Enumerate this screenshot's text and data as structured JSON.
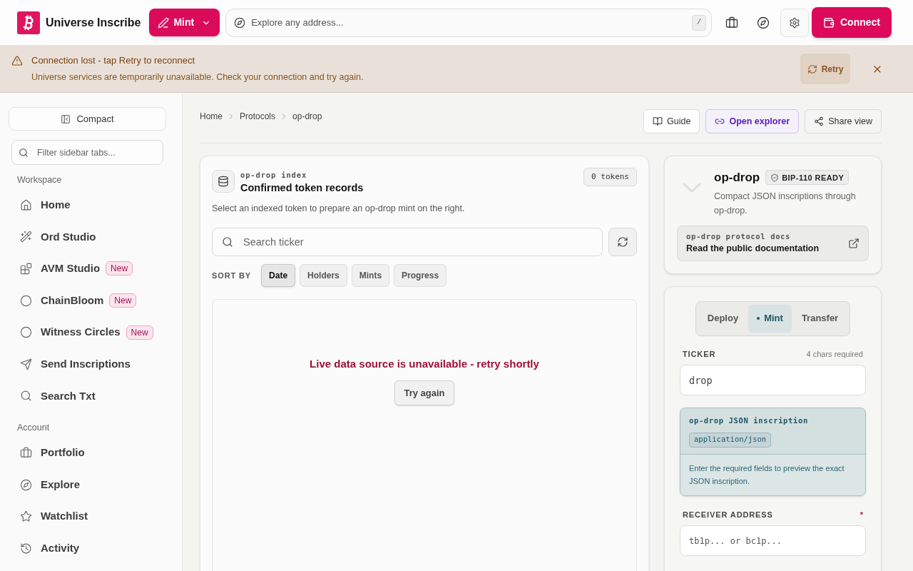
{
  "header": {
    "brand": "Universe Inscribe",
    "mint_button": "Mint",
    "search": {
      "placeholder": "Explore any address...",
      "shortcut": "/"
    },
    "connect_button": "Connect"
  },
  "banner": {
    "title": "Connection lost - tap Retry to reconnect",
    "message": "Universe services are temporarily unavailable. Check your connection and try again.",
    "retry_button": "Retry"
  },
  "sidebar": {
    "compact_button": "Compact",
    "filter": {
      "placeholder": "Filter sidebar tabs..."
    },
    "sections": [
      {
        "title": "Workspace",
        "items": [
          {
            "label": "Home"
          },
          {
            "label": "Ord Studio"
          },
          {
            "label": "AVM Studio",
            "badge": "New"
          },
          {
            "label": "ChainBloom",
            "badge": "New"
          },
          {
            "label": "Witness Circles",
            "badge": "New"
          },
          {
            "label": "Send Inscriptions"
          },
          {
            "label": "Search Txt"
          }
        ]
      },
      {
        "title": "Account",
        "items": [
          {
            "label": "Portfolio"
          },
          {
            "label": "Explore"
          },
          {
            "label": "Watchlist"
          },
          {
            "label": "Activity"
          }
        ]
      }
    ]
  },
  "breadcrumb": [
    "Home",
    "Protocols",
    "op-drop"
  ],
  "actions": [
    {
      "label": "Guide",
      "kind": "solid"
    },
    {
      "label": "Open explorer",
      "kind": "accent"
    },
    {
      "label": "Share view",
      "kind": "ghost"
    }
  ],
  "index_card": {
    "eyebrow": "op-drop index",
    "title": "Confirmed token records",
    "count": "0 tokens",
    "description": "Select an indexed token to prepare an op-drop mint on the right.",
    "search": {
      "placeholder": "Search ticker"
    },
    "sort_label": "SORT BY",
    "sort_options": [
      {
        "label": "Date",
        "selected": true
      },
      {
        "label": "Holders",
        "selected": false
      },
      {
        "label": "Mints",
        "selected": false
      },
      {
        "label": "Progress",
        "selected": false
      }
    ],
    "error": "Live data source is unavailable - retry shortly",
    "retry_button": "Try again"
  },
  "protocol_card": {
    "name": "op-drop",
    "badge": "BIP-110 READY",
    "description": "Compact JSON inscriptions through op-drop.",
    "docs": {
      "eyebrow": "op-drop protocol docs",
      "title": "Read the public documentation"
    }
  },
  "mint_form": {
    "tabs": [
      {
        "label": "Deploy",
        "selected": false
      },
      {
        "label": "Mint",
        "selected": true
      },
      {
        "label": "Transfer",
        "selected": false
      }
    ],
    "ticker": {
      "label": "TICKER",
      "hint": "4 chars required",
      "value": "drop"
    },
    "preview": {
      "title": "op-drop JSON inscription",
      "content_type": "application/json",
      "message": "Enter the required fields to preview the exact JSON inscription."
    },
    "receiver": {
      "label": "RECEIVER ADDRESS",
      "required_mark": "*",
      "placeholder": "tb1p... or bc1p..."
    }
  }
}
